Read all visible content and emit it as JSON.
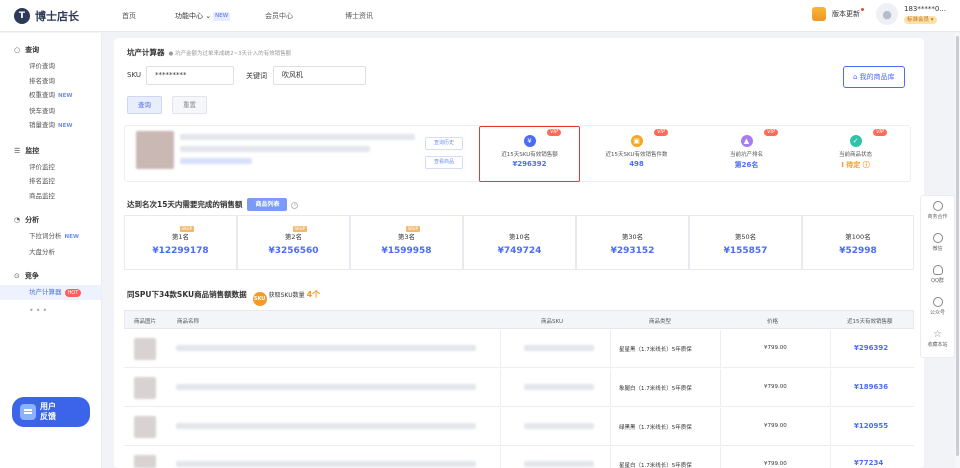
{
  "app": {
    "logo_mark": "T",
    "name": "博士店长"
  },
  "nav": {
    "items": [
      {
        "label": "首页",
        "badge": ""
      },
      {
        "label": "功能中心",
        "badge": "NEW",
        "chevron": "⌄"
      },
      {
        "label": "会员中心",
        "badge": ""
      },
      {
        "label": "博士资讯",
        "badge": ""
      }
    ]
  },
  "topbar": {
    "update_label": "版本更新",
    "user_phone": "183*****0...",
    "member_badge": "标准会员 ▾"
  },
  "sidebar": {
    "sections": [
      {
        "title": "查询",
        "icon": "search-icon",
        "items": [
          {
            "label": "评价查询",
            "tag": ""
          },
          {
            "label": "排名查询",
            "tag": ""
          },
          {
            "label": "权重查询",
            "tag": "NEW"
          },
          {
            "label": "快车查询",
            "tag": ""
          },
          {
            "label": "销量查询",
            "tag": "NEW"
          }
        ]
      },
      {
        "title": "监控",
        "icon": "monitor-icon",
        "items": [
          {
            "label": "评价监控",
            "tag": ""
          },
          {
            "label": "排名监控",
            "tag": ""
          },
          {
            "label": "商品监控",
            "tag": ""
          }
        ]
      },
      {
        "title": "分析",
        "icon": "analysis-icon",
        "items": [
          {
            "label": "下拉词分析",
            "tag": "NEW"
          },
          {
            "label": "大盘分析",
            "tag": ""
          }
        ]
      },
      {
        "title": "竞争",
        "icon": "compete-icon",
        "items": [
          {
            "label": "坑产计算器",
            "tag": "HOT"
          }
        ]
      }
    ],
    "more": "•••",
    "feedback": {
      "line1": "用户",
      "line2": "反馈"
    }
  },
  "calculator": {
    "title": "坑产计算器",
    "hint": "● 坑产金额为过单来成统2~3天计入的有效销售额",
    "sku_label": "SKU",
    "sku_value": "*********",
    "keyword_label": "关键词",
    "keyword_value": "吹风机",
    "query_button": "查询",
    "reset_button": "重置",
    "my_library_button": "我的商品库"
  },
  "product": {
    "history_button": "查询历史",
    "view_button": "查看商品"
  },
  "stats": [
    {
      "label": "近15天SKU有效销售额",
      "value": "¥296392",
      "vip": "VIP",
      "color": "#4a6cf7",
      "icon": "yuan-icon",
      "glyph": "¥"
    },
    {
      "label": "近15天SKU有效销售件数",
      "value": "498",
      "vip": "VIP",
      "color": "#f5a623",
      "icon": "box-icon",
      "glyph": "▣"
    },
    {
      "label": "当前坑产排名",
      "value": "第26名",
      "vip": "VIP",
      "color": "#a77df0",
      "icon": "rank-icon",
      "glyph": "▲"
    },
    {
      "label": "当前商品状态",
      "value": "Ⅰ 待定 ⓘ",
      "vip": "VIP",
      "color": "#2fc2a8",
      "icon": "status-icon",
      "glyph": "✓"
    }
  ],
  "rank_section": {
    "title": "达到名次15天内需要完成的销售额",
    "button": "商品列表",
    "info": "i",
    "ranks": [
      {
        "label": "第1名",
        "value": "¥12299178"
      },
      {
        "label": "第2名",
        "value": "¥3256560"
      },
      {
        "label": "第3名",
        "value": "¥1599958"
      },
      {
        "label": "第10名",
        "value": "¥749724"
      },
      {
        "label": "第30名",
        "value": "¥293152"
      },
      {
        "label": "第50名",
        "value": "¥155857"
      },
      {
        "label": "第100名",
        "value": "¥52998"
      }
    ],
    "tag": "SKUP"
  },
  "spu_section": {
    "title": "同SPU下34款SKU商品销售额数据",
    "count_icon": "SKU",
    "count_label": "获取SKU数量",
    "count_value": "4个"
  },
  "table": {
    "headers": [
      "商品图片",
      "商品名称",
      "商品SKU",
      "商品类型",
      "价格",
      "近15天有效销售额"
    ],
    "rows": [
      {
        "type": "星星黑（1.7米线长）5年质保",
        "price": "¥799.00",
        "sales": "¥296392"
      },
      {
        "type": "象腿白（1.7米线长）5年质保",
        "price": "¥799.00",
        "sales": "¥189636"
      },
      {
        "type": "绿黑黑（1.7米线长）5年质保",
        "price": "¥799.00",
        "sales": "¥120955"
      },
      {
        "type": "星星白（1.7米线长）5年质保",
        "price": "¥799.00",
        "sales": "¥77234"
      }
    ]
  },
  "rightbar": [
    {
      "label": "商务合作",
      "icon": "handshake-icon"
    },
    {
      "label": "微信",
      "icon": "wechat-icon"
    },
    {
      "label": "QQ群",
      "icon": "qq-icon"
    },
    {
      "label": "公众号",
      "icon": "official-account-icon"
    },
    {
      "label": "收藏本站",
      "icon": "star-icon"
    }
  ]
}
